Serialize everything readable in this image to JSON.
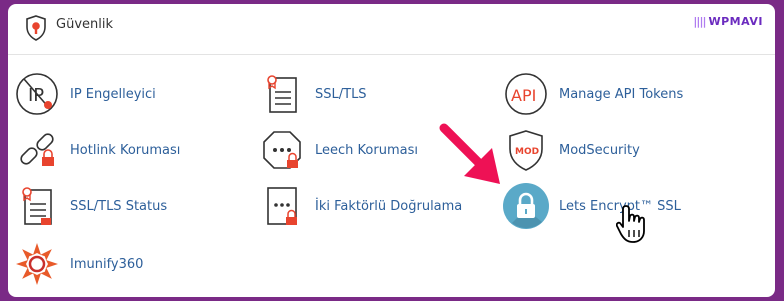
{
  "section": {
    "title": "Güvenlik",
    "icon": "shield-icon"
  },
  "brand": {
    "bars": "||||",
    "label": "WPMAVI"
  },
  "items": [
    {
      "label": "IP Engelleyici",
      "icon": "ip-blocker-icon"
    },
    {
      "label": "SSL/TLS",
      "icon": "ssl-certificate-icon"
    },
    {
      "label": "Manage API Tokens",
      "icon": "api-icon",
      "icon_text": "API"
    },
    {
      "label": "Hotlink Koruması",
      "icon": "hotlink-chain-icon"
    },
    {
      "label": "Leech Koruması",
      "icon": "leech-protection-icon"
    },
    {
      "label": "ModSecurity",
      "icon": "modsecurity-shield-icon",
      "icon_text": "MOD"
    },
    {
      "label": "SSL/TLS Status",
      "icon": "ssl-status-icon"
    },
    {
      "label": "İki Faktörlü Doğrulama",
      "icon": "two-factor-icon"
    },
    {
      "label": "Lets Encrypt™ SSL",
      "icon": "lock-icon"
    },
    {
      "label": "Imunify360",
      "icon": "imunify360-icon"
    }
  ],
  "colors": {
    "accent_purple": "#7a2a86",
    "link_blue": "#2d5f9a",
    "arrow_red": "#ee1155",
    "lock_teal": "#5aa9c8"
  }
}
